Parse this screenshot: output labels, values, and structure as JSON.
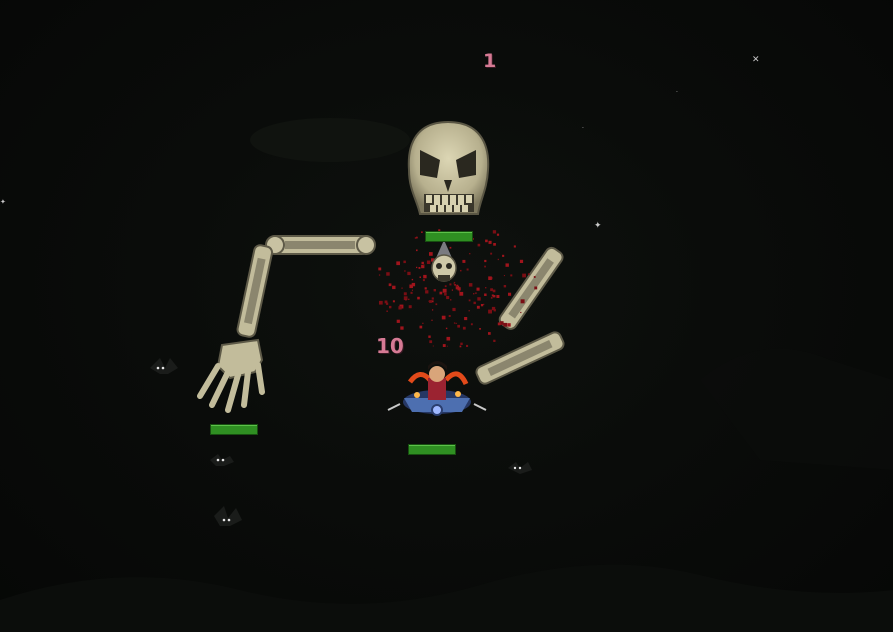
{
  "hud": {
    "damage_numbers": [
      "1",
      "10"
    ]
  },
  "health_bars": {
    "boss_head": 1.0,
    "boss_hand": 1.0,
    "player": 1.0
  },
  "colors": {
    "background": "#070807",
    "bone": "#c9c4a4",
    "bone_dark": "#6f6b55",
    "blood": "#a0141c",
    "damage_text": "#d67a94",
    "health_bar": "#2f8f22"
  },
  "sprites": {
    "boss": "skeletron-boss",
    "player": "player-character",
    "enemies": [
      "cave-bat",
      "cave-bat",
      "cave-bat"
    ]
  }
}
